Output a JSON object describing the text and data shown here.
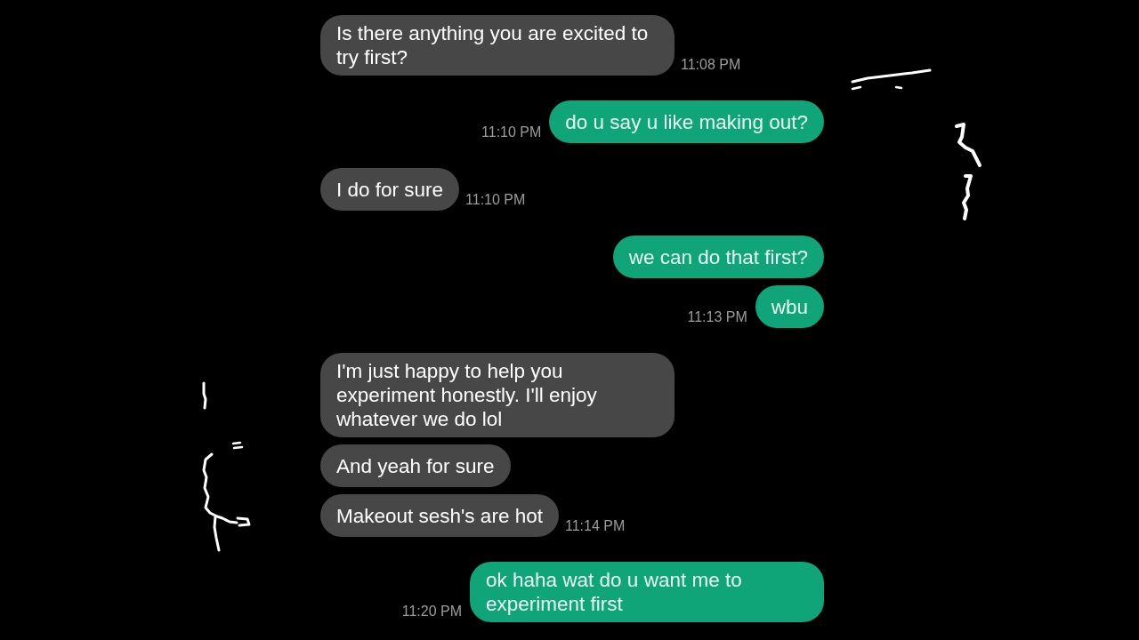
{
  "messages": [
    {
      "kind": "received",
      "text": "Is there anything you are excited to try first?",
      "time": "11:08 PM"
    },
    {
      "kind": "sent",
      "text": "do u say u like making out?",
      "time": "11:10 PM"
    },
    {
      "kind": "received",
      "text": "I do for sure",
      "time": "11:10 PM"
    },
    {
      "kind": "sent",
      "text": "we can do that first?"
    },
    {
      "kind": "sent",
      "text": "wbu",
      "time": "11:13 PM"
    },
    {
      "kind": "received",
      "text": "I'm just happy to help you experiment honestly. I'll enjoy whatever we do lol"
    },
    {
      "kind": "received",
      "text": "And yeah for sure"
    },
    {
      "kind": "received",
      "text": "Makeout sesh's are hot",
      "time": "11:14 PM"
    },
    {
      "kind": "sent",
      "text": "ok haha wat do u want me to experiment first",
      "time": "11:20 PM"
    }
  ]
}
